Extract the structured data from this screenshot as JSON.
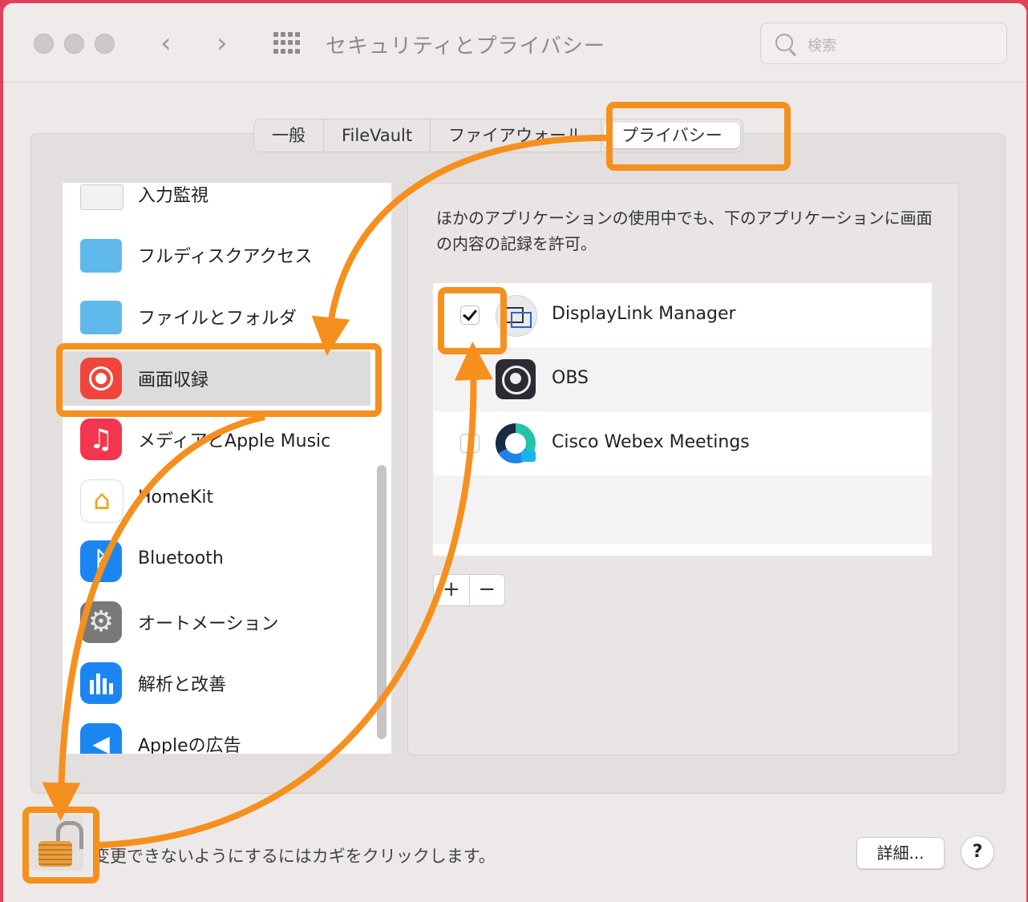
{
  "window": {
    "title": "セキュリティとプライバシー"
  },
  "search": {
    "placeholder": "検索"
  },
  "tabs": [
    {
      "label": "一般"
    },
    {
      "label": "FileVault"
    },
    {
      "label": "ファイアウォール"
    },
    {
      "label": "プライバシー",
      "active": true
    }
  ],
  "sidebar": {
    "items": [
      {
        "label": "入力監視",
        "icon": "keyboard-icon"
      },
      {
        "label": "フルディスクアクセス",
        "icon": "folder-icon"
      },
      {
        "label": "ファイルとフォルダ",
        "icon": "folder-icon"
      },
      {
        "label": "画面収録",
        "icon": "screen-record-icon",
        "selected": true
      },
      {
        "label": "メディアとApple Music",
        "icon": "music-icon"
      },
      {
        "label": "HomeKit",
        "icon": "home-icon"
      },
      {
        "label": "Bluetooth",
        "icon": "bluetooth-icon"
      },
      {
        "label": "オートメーション",
        "icon": "gear-icon"
      },
      {
        "label": "解析と改善",
        "icon": "chart-icon"
      },
      {
        "label": "Appleの広告",
        "icon": "megaphone-icon"
      }
    ]
  },
  "detail": {
    "description": "ほかのアプリケーションの使用中でも、下のアプリケーションに画面の内容の記録を許可。",
    "apps": [
      {
        "name": "DisplayLink Manager",
        "checked": true
      },
      {
        "name": "OBS",
        "checked": false
      },
      {
        "name": "Cisco Webex Meetings",
        "checked": false
      }
    ],
    "add_label": "+",
    "remove_label": "−"
  },
  "footer": {
    "lock_text": "変更できないようにするにはカギをクリックします。",
    "advanced_label": "詳細...",
    "help_label": "?"
  },
  "colors": {
    "highlight": "#f5901e",
    "background": "#e0405a"
  }
}
